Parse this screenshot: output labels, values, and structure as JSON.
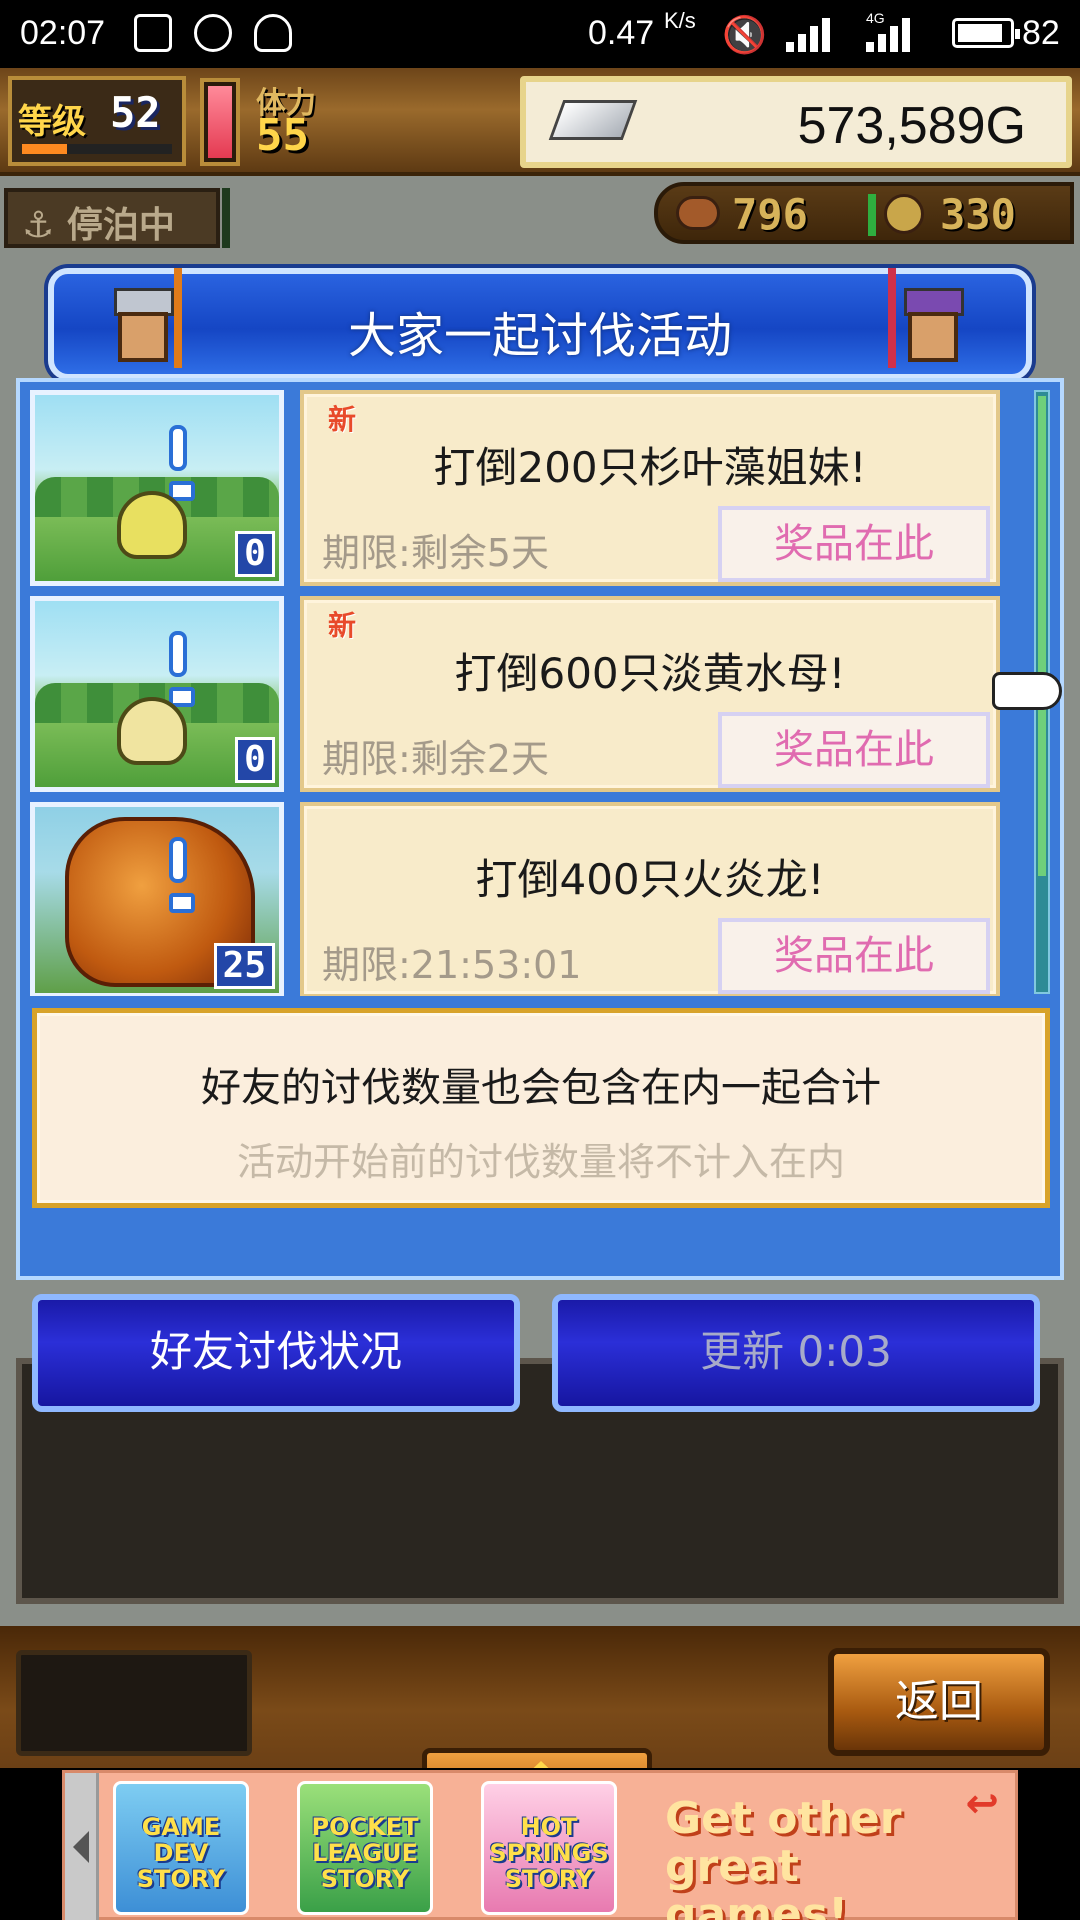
{
  "status_bar": {
    "time": "02:07",
    "net_speed": "0.47",
    "net_unit": "K/s",
    "network_type": "4G",
    "battery": "82",
    "icons": [
      "image-icon",
      "sync-icon",
      "qq-icon",
      "mute-icon",
      "signal-icon",
      "signal-4g-icon",
      "battery-icon"
    ]
  },
  "hud": {
    "level_label": "等级",
    "level": "52",
    "stamina_label": "体力",
    "stamina": "55",
    "money": "573,589G",
    "status": "停泊中",
    "resource_1": "796",
    "resource_2": "330"
  },
  "dialog": {
    "title": "大家一起讨伐活动",
    "events": [
      {
        "new_label": "新",
        "goal": "打倒200只杉叶藻姐妹!",
        "deadline": "期限:剩余5天",
        "prize_button": "奖品在此",
        "defeated": "0"
      },
      {
        "new_label": "新",
        "goal": "打倒600只淡黄水母!",
        "deadline": "期限:剩余2天",
        "prize_button": "奖品在此",
        "defeated": "0"
      },
      {
        "new_label": "",
        "goal": "打倒400只火炎龙!",
        "deadline": "期限:21:53:01",
        "prize_button": "奖品在此",
        "defeated": "25"
      }
    ],
    "info_line1": "好友的讨伐数量也会包含在内一起合计",
    "info_line2": "活动开始前的讨伐数量将不计入在内"
  },
  "buttons": {
    "friend_status": "好友讨伐状况",
    "refresh": "更新 0:03",
    "back": "返回"
  },
  "ad_banner": {
    "tiles": [
      "GAME DEV STORY",
      "POCKET LEAGUE STORY",
      "HOT SPRINGS STORY"
    ],
    "cta": "Get other great games!"
  },
  "colors": {
    "dialog_blue": "#3b7ad9",
    "card_bg": "#f8ebca",
    "prize_text": "#e06bb0",
    "new_tag": "#e84a2a"
  }
}
